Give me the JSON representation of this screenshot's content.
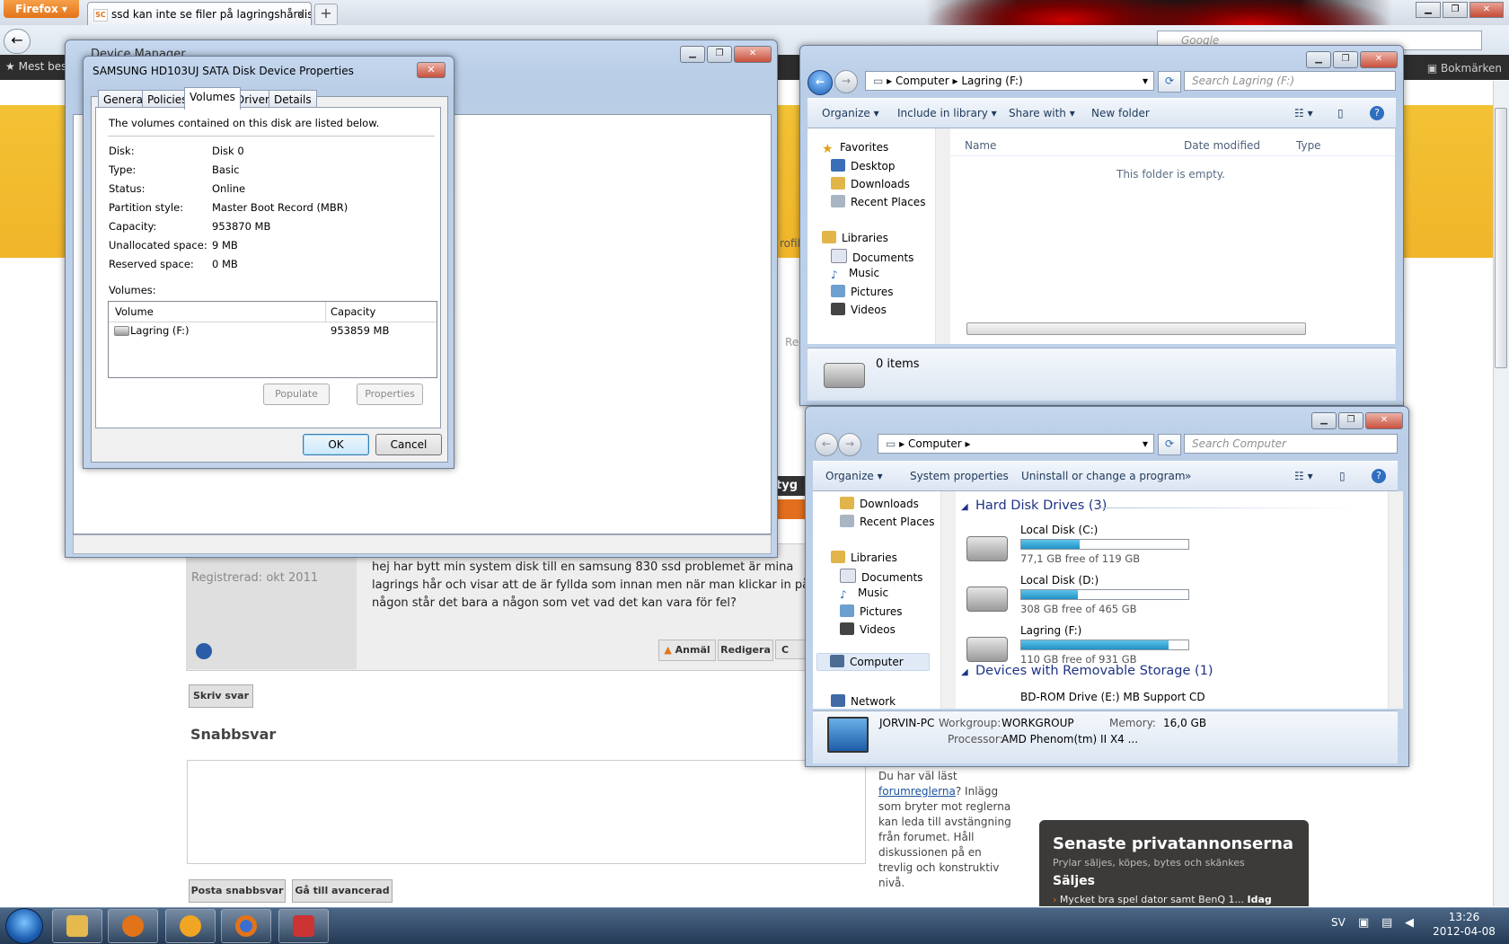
{
  "browser": {
    "menu_button": "Firefox",
    "tab_title": "ssd kan inte se filer på lagringshårdisk - ...",
    "tab_favicon": "SC",
    "newtab": "+",
    "search_placeholder": "Google",
    "bookmarks_left": "Mest bes",
    "bookmarks_right": "Bokmärken"
  },
  "forum": {
    "registered": "Registrerad: okt 2011",
    "post_text": "hej har bytt min system disk till en samsung 830 ssd problemet är mina lagrings hår och visar att de är fyllda som innan men när man klickar in på någon står det bara a någon som vet vad det kan vara för fel?",
    "btn_report": "Anmäl",
    "btn_edit": "Redigera",
    "btn_c": "C",
    "write_reply": "Skriv svar",
    "quick_reply_heading": "Snabbsvar",
    "post_quick": "Posta snabbsvar",
    "goto_advanced": "Gå till avancerad",
    "note_prefix": "Du har väl läst",
    "note_link": "forumreglerna",
    "note_suffix": "? Inlägg som bryter mot reglerna kan leda till avstängning från forumet. Håll diskussionen på en trevlig och konstruktiv nivå.",
    "tyg_strip": "tyg",
    "profil_fragment": "rofil",
    "reg_fragment": "Reg",
    "ads": {
      "title": "Senaste privatannonserna",
      "subtitle": "Prylar säljes, köpes, bytes och skänkes",
      "section": "Säljes",
      "item": "Mycket bra spel dator samt BenQ 1...",
      "item_when": "Idag"
    }
  },
  "device_manager": {
    "title": "Device Manager"
  },
  "properties_dialog": {
    "title": "SAMSUNG HD103UJ SATA Disk Device Properties",
    "tabs": [
      "General",
      "Policies",
      "Volumes",
      "Driver",
      "Details"
    ],
    "active_tab": "Volumes",
    "intro": "The volumes contained on this disk are listed below.",
    "fields": [
      {
        "label": "Disk:",
        "value": "Disk 0"
      },
      {
        "label": "Type:",
        "value": "Basic"
      },
      {
        "label": "Status:",
        "value": "Online"
      },
      {
        "label": "Partition style:",
        "value": "Master Boot Record (MBR)"
      },
      {
        "label": "Capacity:",
        "value": "953870 MB"
      },
      {
        "label": "Unallocated space:",
        "value": "9 MB"
      },
      {
        "label": "Reserved space:",
        "value": "0 MB"
      }
    ],
    "volumes_label": "Volumes:",
    "columns": [
      "Volume",
      "Capacity"
    ],
    "rows": [
      {
        "volume": "Lagring (F:)",
        "capacity": "953859 MB"
      }
    ],
    "btn_populate": "Populate",
    "btn_properties": "Properties",
    "btn_ok": "OK",
    "btn_cancel": "Cancel"
  },
  "explorer_lagring": {
    "breadcrumb": [
      "Computer",
      "Lagring (F:)"
    ],
    "search_placeholder": "Search Lagring (F:)",
    "toolbar": [
      "Organize",
      "Include in library",
      "Share with",
      "New folder"
    ],
    "nav": {
      "favorites": "Favorites",
      "favorites_items": [
        "Desktop",
        "Downloads",
        "Recent Places"
      ],
      "libraries": "Libraries",
      "libraries_items": [
        "Documents",
        "Music",
        "Pictures",
        "Videos"
      ]
    },
    "columns": [
      "Name",
      "Date modified",
      "Type"
    ],
    "empty_text": "This folder is empty.",
    "items_count": "0 items"
  },
  "explorer_computer": {
    "breadcrumb": [
      "Computer"
    ],
    "search_placeholder": "Search Computer",
    "toolbar": [
      "Organize",
      "System properties",
      "Uninstall or change a program",
      "»"
    ],
    "nav": {
      "top_items": [
        "Downloads",
        "Recent Places"
      ],
      "libraries": "Libraries",
      "libraries_items": [
        "Documents",
        "Music",
        "Pictures",
        "Videos"
      ],
      "computer": "Computer",
      "network": "Network"
    },
    "hdd_heading": "Hard Disk Drives (3)",
    "drives": [
      {
        "name": "Local Disk (C:)",
        "free": "77,1 GB free of 119 GB",
        "used_fraction": 0.35
      },
      {
        "name": "Local Disk (D:)",
        "free": "308 GB free of 465 GB",
        "used_fraction": 0.34
      },
      {
        "name": "Lagring (F:)",
        "free": "110 GB free of 931 GB",
        "used_fraction": 0.88
      }
    ],
    "removable_heading": "Devices with Removable Storage (1)",
    "removable_item": "BD-ROM Drive (E:) MB Support CD",
    "details": {
      "pc_name": "JORVIN-PC",
      "workgroup_label": "Workgroup:",
      "workgroup": "WORKGROUP",
      "memory_label": "Memory:",
      "memory": "16,0 GB",
      "processor_label": "Processor:",
      "processor": "AMD Phenom(tm) II X4 ..."
    }
  },
  "taskbar": {
    "language": "SV",
    "time": "13:26",
    "date": "2012-04-08"
  }
}
